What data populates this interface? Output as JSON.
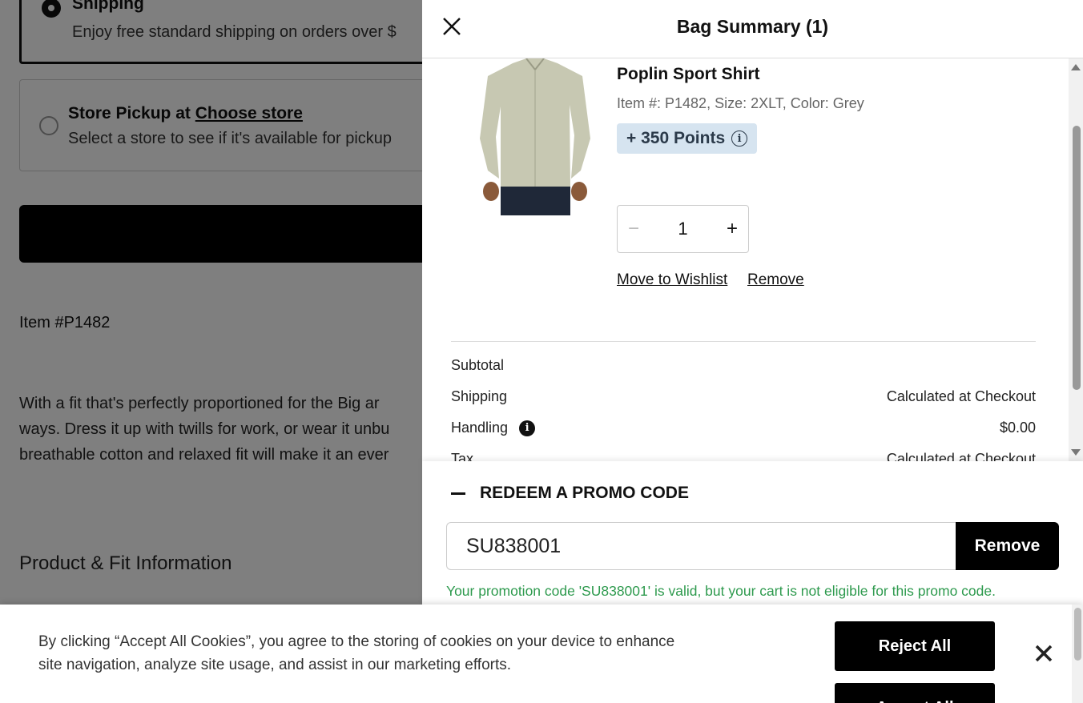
{
  "background": {
    "shipping_option": {
      "title": "Shipping",
      "subtitle": "Enjoy free standard shipping on orders over $"
    },
    "pickup_option": {
      "title_prefix": "Store Pickup at ",
      "title_link": "Choose store",
      "subtitle": "Select a store to see if it's available for pickup"
    },
    "item_number": "Item #P1482",
    "description_lines": [
      "With a fit that's perfectly proportioned for the Big ar",
      "ways. Dress it up with twills for work, or wear it unbu",
      "breathable cotton and relaxed fit will make it an ever"
    ],
    "section_heading": "Product & Fit Information"
  },
  "drawer": {
    "title": "Bag Summary (1)",
    "close_icon": "close-icon",
    "item": {
      "name": "Poplin Sport Shirt",
      "meta": "Item #: P1482, Size: 2XLT, Color: Grey",
      "points": "+ 350 Points",
      "quantity": "1",
      "minus_symbol": "−",
      "plus_symbol": "+",
      "move_to_wishlist": "Move to Wishlist",
      "remove": "Remove"
    },
    "summary": {
      "subtotal_label": "Subtotal",
      "subtotal_value": "",
      "shipping_label": "Shipping",
      "shipping_value": "Calculated at Checkout",
      "handling_label": "Handling",
      "handling_value": "$0.00",
      "tax_label": "Tax",
      "tax_value": "Calculated at Checkout"
    },
    "promo": {
      "heading": "REDEEM A PROMO CODE",
      "code_value": "SU838001",
      "remove_label": "Remove",
      "message": "Your promotion code 'SU838001' is valid, but your cart is not eligible for this promo code."
    }
  },
  "cookie_banner": {
    "text": "By clicking “Accept All Cookies”, you agree to the storing of cookies on your device to enhance site navigation, analyze site usage, and assist in our marketing efforts.",
    "reject_label": "Reject All",
    "accept_label": "Accept All"
  },
  "colors": {
    "accent_black": "#000000",
    "points_bg": "#d6e4f0",
    "success_green": "#2e9a4e"
  }
}
